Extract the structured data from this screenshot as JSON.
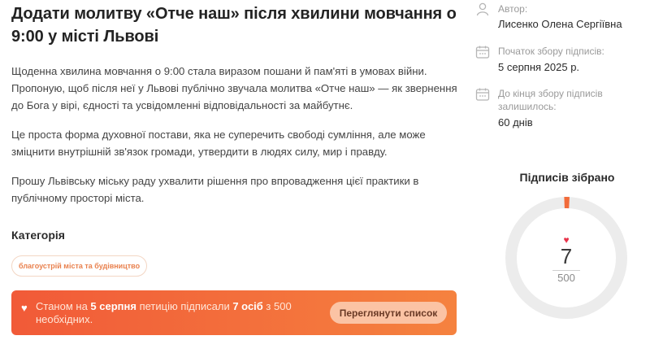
{
  "petition": {
    "title": "Додати молитву «Отче наш» після хвилини мовчання о 9:00 у місті Львові",
    "paragraphs": [
      "Щоденна хвилина мовчання о 9:00 стала виразом пошани й пам'яті в умовах війни. Пропоную, щоб після неї у Львові публічно звучала молитва «Отче наш» — як звернення до Бога у вірі, єдності та усвідомленні відповідальності за майбутнє.",
      "Це проста форма духовної постави, яка не суперечить свободі сумління, але може зміцнити внутрішній зв'язок громади, утвердити в людях силу, мир і правду.",
      "Прошу Львівську міську раду ухвалити рішення про впровадження цієї практики в публічному просторі міста."
    ],
    "category_heading": "Категорія",
    "category_tag": "благоустрій міста та будівництво"
  },
  "banner": {
    "text_before_date": "Станом на ",
    "date": "5 серпня",
    "text_middle": " петицію підписали ",
    "signers": "7 осіб",
    "text_after": " з 500 необхідних.",
    "button_label": "Переглянути список"
  },
  "sidebar": {
    "author_label": "Автор:",
    "author_value": "Лисенко Олена Сергіївна",
    "start_label": "Початок збору підписів:",
    "start_value": "5 серпня 2025 р.",
    "remaining_label": "До кінця збору підписів залишилось:",
    "remaining_value": "60 днів",
    "signatures_title": "Підписів зібрано",
    "signatures_count": "7",
    "signatures_goal": "500"
  },
  "colors": {
    "accent": "#f26b3a",
    "ring_bg": "#ececec",
    "heart": "#e8334a"
  },
  "icons": {
    "author": "user-icon",
    "start": "calendar-icon",
    "remaining": "calendar-icon",
    "banner": "heart-icon",
    "counter": "heart-icon"
  },
  "progress": {
    "fraction": 0.014
  }
}
